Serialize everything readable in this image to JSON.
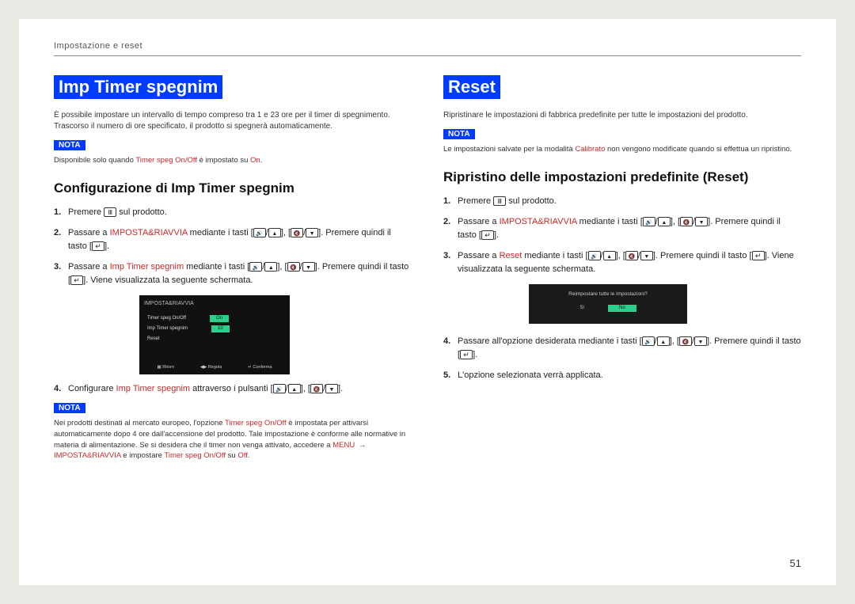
{
  "header": "Impostazione e reset",
  "pageNumber": "51",
  "notaLabel": "NOTA",
  "left": {
    "h1": "Imp Timer spegnim",
    "intro": "È possibile impostare un intervallo di tempo compreso tra 1 e 23 ore per il timer di spegnimento. Trascorso il numero di ore specificato, il prodotto si spegnerà automaticamente.",
    "nota1_pre": "Disponibile solo quando ",
    "nota1_link": "Timer speg On/Off",
    "nota1_mid": " è impostato su ",
    "nota1_on": "On",
    "nota1_post": ".",
    "h2": "Configurazione di Imp Timer spegnim",
    "steps": {
      "s1_a": "Premere ",
      "s1_b": " sul prodotto.",
      "s2_a": "Passare a ",
      "s2_link": "IMPOSTA&RIAVVIA",
      "s2_b": " mediante i tasti ",
      "s2_c": ". Premere quindi il tasto ",
      "s3_a": "Passare a ",
      "s3_link": "Imp Timer spegnim",
      "s3_b": " mediante i tasti ",
      "s3_c": ". Premere quindi il tasto ",
      "s3_d": ". Viene visualizzata la seguente schermata.",
      "s4_a": "Configurare ",
      "s4_link": "Imp Timer spegnim",
      "s4_b": " attraverso i pulsanti "
    },
    "screen": {
      "title": "IMPOSTA&RIAVVIA",
      "row1a": "Timer speg On/Off",
      "row1b": "On",
      "row2a": "Imp Timer spegnim",
      "row2b": "10",
      "row3": "Reset",
      "f1": "Ritorn",
      "f2": "Regola",
      "f3": "Conferma"
    },
    "nota2_pre": "Nei prodotti destinati al mercato europeo, l'opzione ",
    "nota2_l1": "Timer speg On/Off",
    "nota2_mid1": " è impostata per attivarsi automaticamente dopo 4 ore dall'accensione del prodotto. Tale impostazione è conforme alle normative in materia di alimentazione. Se si desidera che il timer non venga attivato, accedere a ",
    "nota2_l2": "MENU",
    "nota2_arrow": " → ",
    "nota2_l3": "IMPOSTA&RIAVVIA",
    "nota2_mid2": " e impostare ",
    "nota2_l4": "Timer speg On/Off",
    "nota2_mid3": " su ",
    "nota2_l5": "Off",
    "nota2_post": "."
  },
  "right": {
    "h1": "Reset",
    "intro": "Ripristinare le impostazioni di fabbrica predefinite per tutte le impostazioni del prodotto.",
    "nota1_pre": "Le impostazioni salvate per la modalità ",
    "nota1_link": "Calibrato",
    "nota1_post": " non vengono modificate quando si effettua un ripristino.",
    "h2": "Ripristino delle impostazioni predefinite (Reset)",
    "steps": {
      "s1_a": "Premere ",
      "s1_b": " sul prodotto.",
      "s2_a": "Passare a ",
      "s2_link": "IMPOSTA&RIAVVIA",
      "s2_b": " mediante i tasti ",
      "s2_c": ". Premere quindi il tasto ",
      "s3_a": "Passare a ",
      "s3_link": "Reset",
      "s3_b": " mediante i tasti ",
      "s3_c": ". Premere quindi il tasto ",
      "s3_d": ". Viene visualizzata la seguente schermata.",
      "s4_a": "Passare all'opzione desiderata mediante i tasti ",
      "s4_b": ". Premere quindi il tasto ",
      "s5": "L'opzione selezionata verrà applicata."
    },
    "screen": {
      "q": "Reimpostare tutte le impostazioni?",
      "opt1": "Sì",
      "opt2": "No"
    }
  }
}
